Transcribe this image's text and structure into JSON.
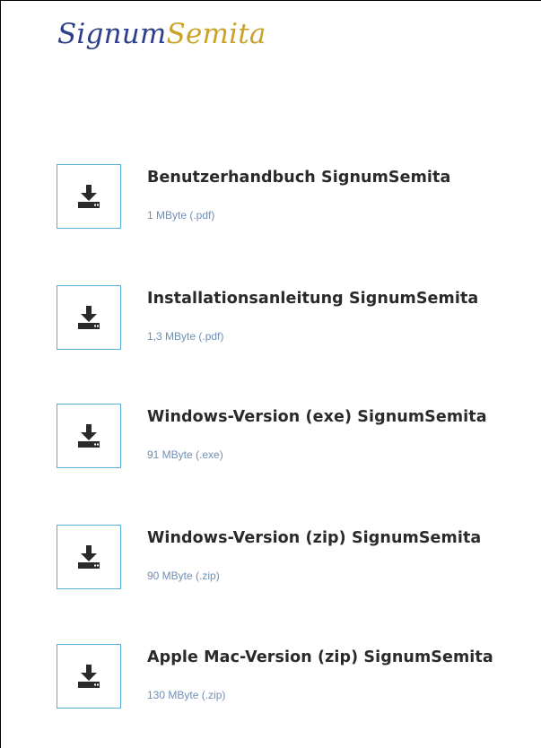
{
  "brand": {
    "part1": "Signum",
    "part2": "Semita"
  },
  "downloads": [
    {
      "title": "Benutzerhandbuch SignumSemita",
      "size": "1 MByte (.pdf)"
    },
    {
      "title": "Installationsanleitung SignumSemita",
      "size": "1,3 MByte (.pdf)"
    },
    {
      "title": "Windows-Version (exe) SignumSemita",
      "size": "91 MByte (.exe)"
    },
    {
      "title": "Windows-Version (zip) SignumSemita",
      "size": "90 MByte (.zip)"
    },
    {
      "title": "Apple Mac-Version (zip) SignumSemita",
      "size": "130 MByte (.zip)"
    }
  ],
  "icon": "download-icon",
  "colors": {
    "brand_blue": "#2c3e8c",
    "brand_gold": "#c9a227",
    "icon_border": "#5aaed6",
    "size_text": "#6f8fb3"
  }
}
